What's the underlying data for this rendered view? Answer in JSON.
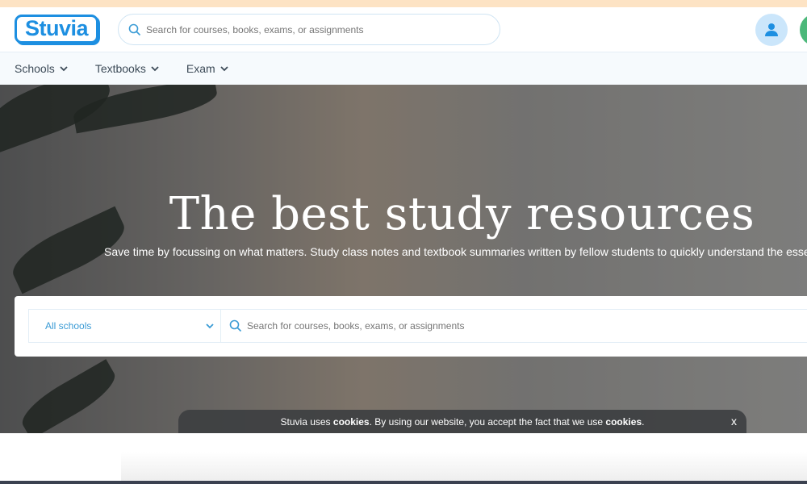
{
  "brand": {
    "logo": "Stuvia",
    "accent": "#1d8fe1"
  },
  "header": {
    "search_placeholder": "Search for courses, books, exams, or assignments"
  },
  "nav": {
    "items": [
      {
        "label": "Schools"
      },
      {
        "label": "Textbooks"
      },
      {
        "label": "Exam"
      }
    ]
  },
  "hero": {
    "title": "The best study resources",
    "subtitle": "Save time by focussing on what matters. Study class notes and textbook summaries written by fellow students to quickly understand the essenti",
    "school_select": "All schools",
    "search_placeholder": "Search for courses, books, exams, or assignments"
  },
  "cookie": {
    "text1": "Stuvia uses ",
    "bold1": "cookies",
    "text2": ". By using our website, you accept the fact that we use ",
    "bold2": "cookies",
    "text3": ".",
    "close": "x"
  }
}
